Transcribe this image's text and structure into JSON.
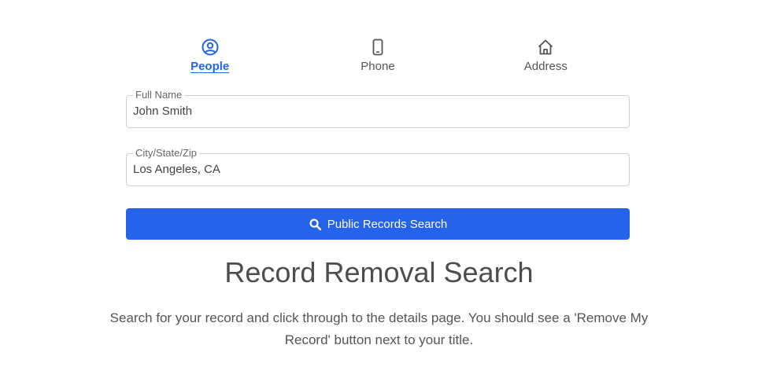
{
  "tabs": [
    {
      "label": "People",
      "icon": "user-circle-icon",
      "active": true
    },
    {
      "label": "Phone",
      "icon": "mobile-phone-icon",
      "active": false
    },
    {
      "label": "Address",
      "icon": "home-icon",
      "active": false
    }
  ],
  "form": {
    "full_name": {
      "label": "Full Name",
      "value": "John Smith"
    },
    "location": {
      "label": "City/State/Zip",
      "value": "Los Angeles, CA"
    },
    "search_button": "Public Records Search"
  },
  "content": {
    "title": "Record Removal Search",
    "description": "Search for your record and click through to the details page. You should see a 'Remove My Record' button next to your title."
  },
  "colors": {
    "accent": "#2563eb",
    "text": "#4d4d4d",
    "border": "#cfcfcf"
  }
}
